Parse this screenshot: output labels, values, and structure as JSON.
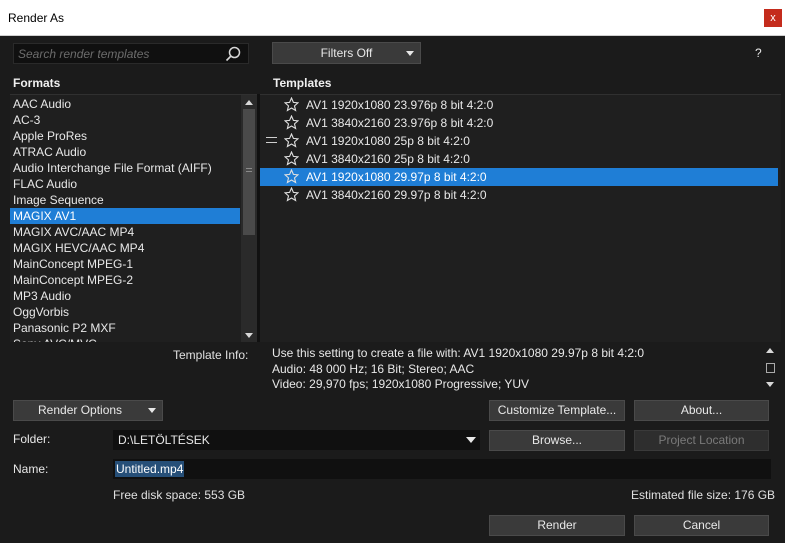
{
  "window": {
    "title": "Render As",
    "close_label": "x"
  },
  "search": {
    "placeholder": "Search render templates"
  },
  "filters": {
    "label": "Filters Off"
  },
  "help_label": "?",
  "formats": {
    "header": "Formats",
    "items": [
      "AAC Audio",
      "AC-3",
      "Apple ProRes",
      "ATRAC Audio",
      "Audio Interchange File Format (AIFF)",
      "FLAC Audio",
      "Image Sequence",
      "MAGIX AV1",
      "MAGIX AVC/AAC MP4",
      "MAGIX HEVC/AAC MP4",
      "MainConcept MPEG-1",
      "MainConcept MPEG-2",
      "MP3 Audio",
      "OggVorbis",
      "Panasonic P2 MXF",
      "Sony AVC/MVC"
    ],
    "selected_index": 7
  },
  "templates": {
    "header": "Templates",
    "items": [
      "AV1 1920x1080 23.976p 8 bit 4:2:0",
      "AV1 3840x2160 23.976p 8 bit 4:2:0",
      "AV1 1920x1080 25p 8 bit 4:2:0",
      "AV1 3840x2160 25p 8 bit 4:2:0",
      "AV1 1920x1080 29.97p 8 bit 4:2:0",
      "AV1 3840x2160 29.97p 8 bit 4:2:0"
    ],
    "selected_index": 4
  },
  "template_info": {
    "label": "Template Info:",
    "lines": [
      "Use this setting to create a file with: AV1 1920x1080 29.97p 8 bit 4:2:0",
      "Audio: 48 000 Hz; 16 Bit; Stereo; AAC",
      "Video: 29,970 fps; 1920x1080 Progressive; YUV"
    ]
  },
  "buttons": {
    "render_options": "Render Options",
    "customize_template": "Customize Template...",
    "about": "About...",
    "browse": "Browse...",
    "project_location": "Project Location",
    "render": "Render",
    "cancel": "Cancel"
  },
  "folder": {
    "label": "Folder:",
    "value": "D:\\LETÖLTÉSEK"
  },
  "name": {
    "label": "Name:",
    "value": "Untitled.mp4"
  },
  "disk": {
    "free_space": "Free disk space: 553 GB",
    "estimated_size": "Estimated file size: 176 GB"
  },
  "colors": {
    "accent": "#1f7ed6",
    "background": "#1b1b1b",
    "close": "#c42b1c"
  }
}
